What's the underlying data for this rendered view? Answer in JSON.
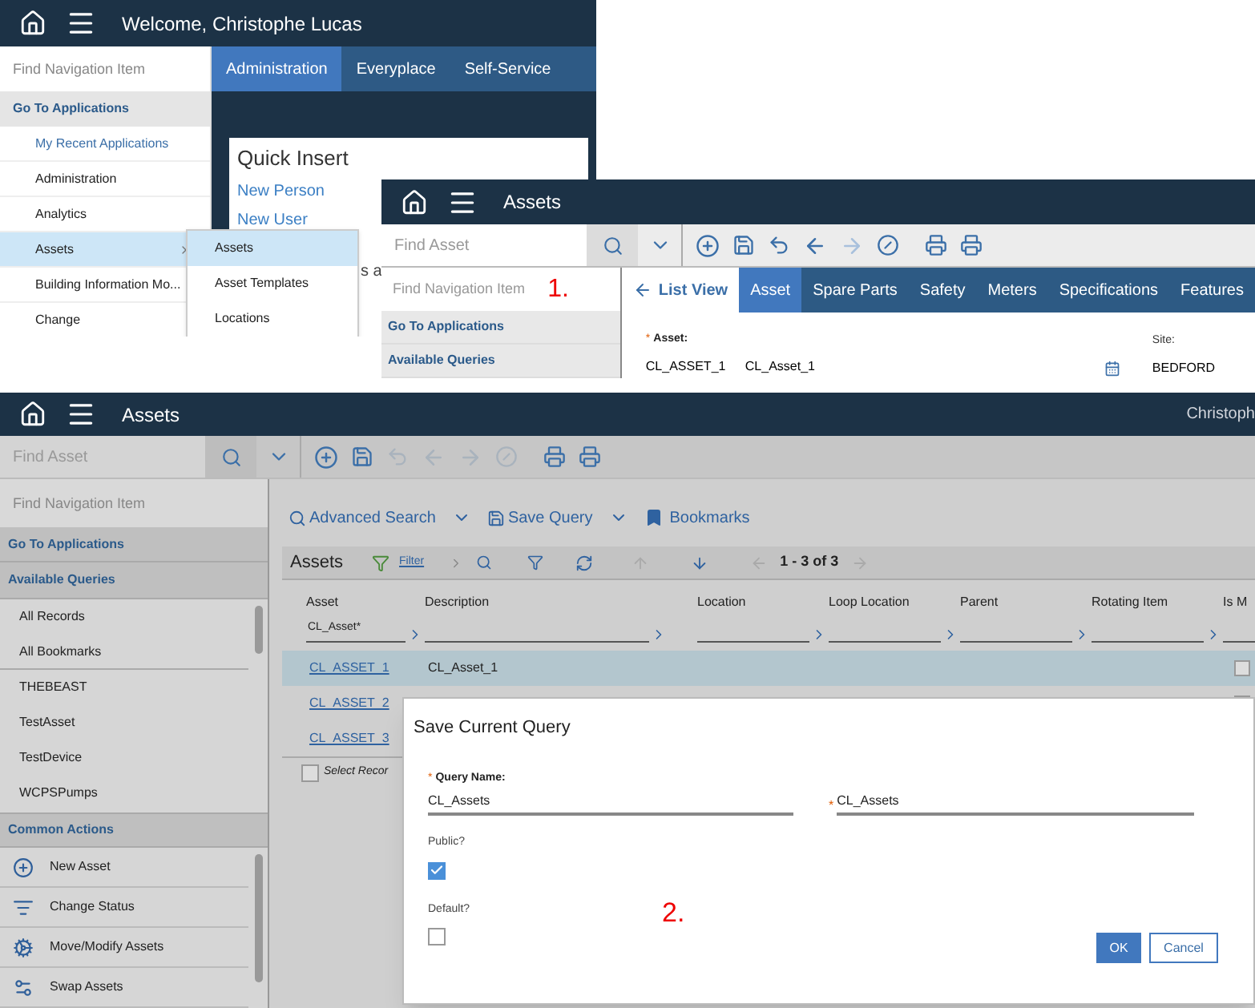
{
  "home_screen": {
    "header": {
      "title": "Welcome, Christophe Lucas"
    },
    "nav": {
      "search_placeholder": "Find Navigation Item",
      "section": "Go To Applications",
      "items": [
        {
          "label": "My Recent Applications",
          "kind": "link",
          "selected": false,
          "has_submenu": false
        },
        {
          "label": "Administration",
          "kind": "item",
          "selected": false,
          "has_submenu": false
        },
        {
          "label": "Analytics",
          "kind": "item",
          "selected": false,
          "has_submenu": false
        },
        {
          "label": "Assets",
          "kind": "item",
          "selected": true,
          "has_submenu": true
        },
        {
          "label": "Building Information Mo...",
          "kind": "item",
          "selected": false,
          "has_submenu": false
        },
        {
          "label": "Change",
          "kind": "item",
          "selected": false,
          "has_submenu": false
        }
      ]
    },
    "tabs": [
      {
        "label": "Administration",
        "selected": true
      },
      {
        "label": "Everyplace",
        "selected": false
      },
      {
        "label": "Self-Service",
        "selected": false
      }
    ],
    "quick_insert": {
      "title": "Quick Insert",
      "links": [
        "New Person",
        "New User"
      ]
    },
    "partial_text": "s a",
    "submenu": [
      {
        "label": "Assets",
        "selected": true
      },
      {
        "label": "Asset Templates",
        "selected": false
      },
      {
        "label": "Locations",
        "selected": false
      }
    ]
  },
  "asset_screen": {
    "header": {
      "title": "Assets"
    },
    "search_placeholder": "Find Asset",
    "nav": {
      "search_placeholder": "Find Navigation Item",
      "step_label": "1.",
      "sections": [
        "Go To Applications",
        "Available Queries"
      ]
    },
    "back_link": "List View",
    "tabs": [
      {
        "label": "Asset",
        "selected": true
      },
      {
        "label": "Spare Parts",
        "selected": false
      },
      {
        "label": "Safety",
        "selected": false
      },
      {
        "label": "Meters",
        "selected": false
      },
      {
        "label": "Specifications",
        "selected": false
      },
      {
        "label": "Features",
        "selected": false
      }
    ],
    "form": {
      "required_mark": "*",
      "asset_label": "Asset:",
      "asset_value": "CL_ASSET_1",
      "description_value": "CL_Asset_1",
      "site_label": "Site:",
      "site_value": "BEDFORD"
    }
  },
  "list_screen": {
    "header": {
      "title": "Assets",
      "user": "Christoph"
    },
    "search_placeholder": "Find Asset",
    "nav": {
      "search_placeholder": "Find Navigation Item",
      "section": "Go To Applications",
      "queries": {
        "title": "Available Queries",
        "items": [
          "All Records",
          "All Bookmarks",
          "THEBEAST",
          "TestAsset",
          "TestDevice",
          "WCPSPumps"
        ]
      },
      "actions": {
        "title": "Common Actions",
        "items": [
          {
            "label": "New Asset",
            "kind": "new"
          },
          {
            "label": "Change Status",
            "kind": "status"
          },
          {
            "label": "Move/Modify Assets",
            "kind": "move"
          },
          {
            "label": "Swap Assets",
            "kind": "swap"
          }
        ]
      }
    },
    "links": [
      "Advanced Search",
      "Save Query",
      "Bookmarks"
    ],
    "table": {
      "title": "Assets",
      "filter": "Filter",
      "pagination": "1 - 3 of 3",
      "columns": [
        {
          "label": "Asset",
          "filter_value": "CL_Asset*"
        },
        {
          "label": "Description"
        },
        {
          "label": "Location"
        },
        {
          "label": "Loop Location"
        },
        {
          "label": "Parent"
        },
        {
          "label": "Rotating Item"
        },
        {
          "label": "Is M"
        }
      ],
      "rows": [
        {
          "asset": "CL_ASSET_1",
          "description": "CL_Asset_1",
          "selected": true
        },
        {
          "asset": "CL_ASSET_2",
          "selected": false
        },
        {
          "asset": "CL_ASSET_3",
          "selected": false
        }
      ],
      "select_all_checked": false,
      "select_records": "Select Recor"
    },
    "dialog": {
      "title": "Save Current Query",
      "query_name_required_mark": "*",
      "query_name_label": "Query Name:",
      "description_required_mark": "*",
      "query_name_value": "CL_Assets",
      "description_value": "CL_Assets",
      "options": [
        {
          "label": "Public?",
          "checked": true
        },
        {
          "label": "Default?",
          "checked": false
        }
      ],
      "step_label": "2.",
      "buttons": [
        {
          "label": "OK",
          "kind": "primary"
        },
        {
          "label": "Cancel",
          "kind": "secondary"
        }
      ]
    }
  }
}
